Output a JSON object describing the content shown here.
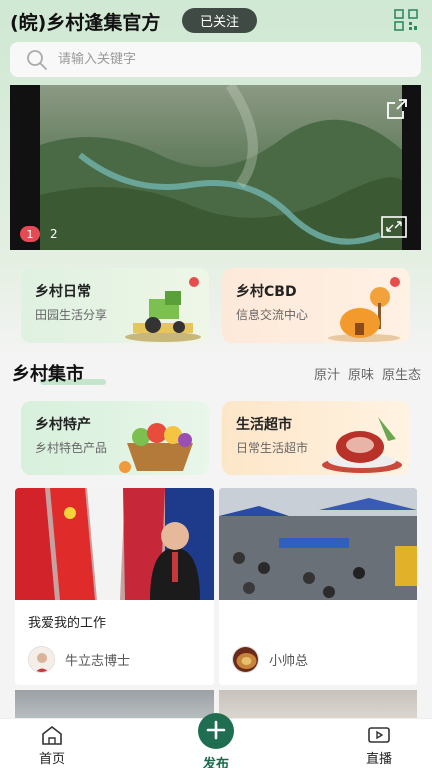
{
  "header": {
    "title": "(皖)乡村逢集官方",
    "follow_label": "已关注"
  },
  "search": {
    "placeholder": "请输入关键字"
  },
  "banner": {
    "current": "1",
    "next": "2"
  },
  "quick_cards": [
    {
      "title": "乡村日常",
      "subtitle": "田园生活分享"
    },
    {
      "title": "乡村CBD",
      "subtitle": "信息交流中心"
    }
  ],
  "market": {
    "title": "乡村集市",
    "tags": [
      "原汁",
      "原味",
      "原生态"
    ],
    "cards": [
      {
        "title": "乡村特产",
        "subtitle": "乡村特色产品"
      },
      {
        "title": "生活超市",
        "subtitle": "日常生活超市"
      }
    ]
  },
  "posts": [
    {
      "title": "我爱我的工作",
      "author": "牛立志博士"
    },
    {
      "title": "",
      "author": "小帅总"
    }
  ],
  "tabbar": {
    "home": "首页",
    "publish": "发布",
    "live": "直播"
  },
  "colors": {
    "accent": "#1f6e52",
    "badge_red": "#e64a55",
    "follow_bg": "#3f4a44"
  }
}
